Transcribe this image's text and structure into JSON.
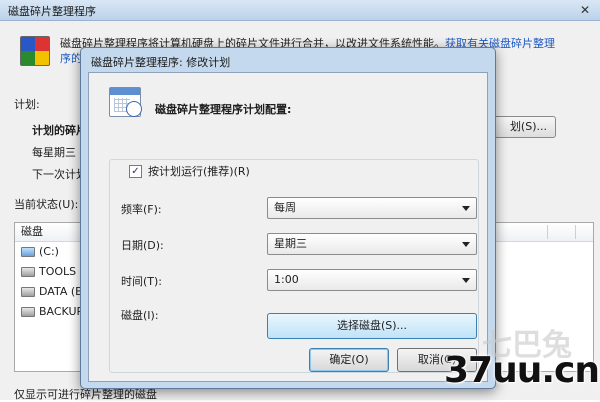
{
  "background": {
    "title": "磁盘碎片整理程序",
    "close_glyph": "✕",
    "intro_line1": "磁盘碎片整理程序将计算机硬盘上的碎片文件进行合并，以改进文件系统性能。",
    "intro_link_line1": "获取有关磁盘碎片整理",
    "intro_link_line2": "序的",
    "schedule_label": "计划:",
    "scheduled_label": "计划的碎片",
    "weekday": "每星期三",
    "next_run": "下一次计划",
    "configure_button": "划(S)...",
    "current_status": "当前状态(U):",
    "disk_column": "磁盘",
    "disks": [
      {
        "name": "(C:)",
        "system": true
      },
      {
        "name": "TOOLS (D",
        "system": false
      },
      {
        "name": "DATA (E:",
        "system": false
      },
      {
        "name": "BACKUP",
        "system": false
      }
    ],
    "footer": "仅显示可进行碎片整理的磁盘"
  },
  "dialog": {
    "title": "磁盘碎片整理程序: 修改计划",
    "heading": "磁盘碎片整理程序计划配置:",
    "run_on_schedule": {
      "checked": true,
      "glyph": "✓",
      "label": "按计划运行(推荐)(R)"
    },
    "frequency": {
      "label": "频率(F):",
      "value": "每周"
    },
    "day": {
      "label": "日期(D):",
      "value": "星期三"
    },
    "time": {
      "label": "时间(T):",
      "value": "1:00"
    },
    "disks": {
      "label": "磁盘(I):",
      "button": "选择磁盘(S)..."
    },
    "ok_button": "确定(O)",
    "cancel_button": "取消(C)"
  },
  "watermark": {
    "text": "37uu.cn",
    "faint_text": "七巴兔"
  }
}
